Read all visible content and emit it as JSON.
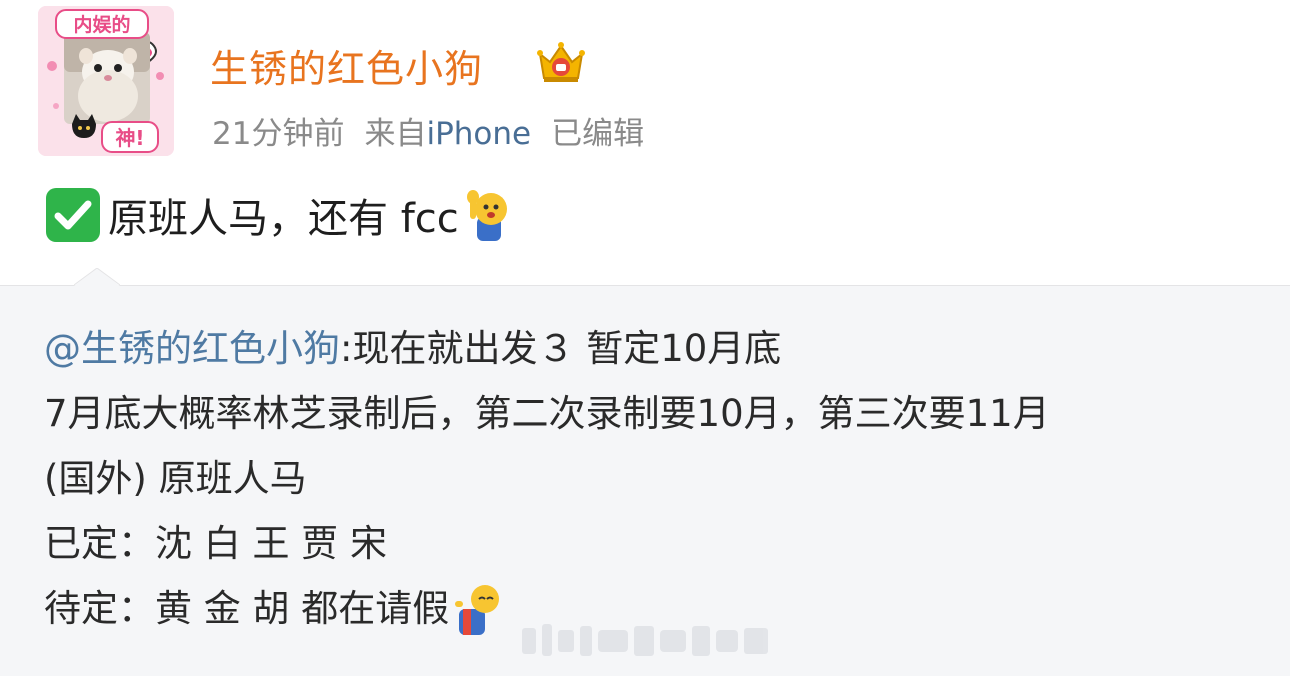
{
  "post": {
    "author": {
      "avatar_icon": "ferret-avatar",
      "avatar_text_top": "内娱的",
      "avatar_text_bottom": "神!",
      "name": "生锈的红色小狗",
      "badge_icon": "crown-badge-icon"
    },
    "meta": {
      "time": "21分钟前",
      "from_label": "来自",
      "source": "iPhone",
      "edited": "已编辑"
    },
    "body": {
      "check_icon": "check-mark-icon",
      "text": "原班人马，还有 fcc",
      "emoji_icon": "waving-emoji-icon"
    },
    "repost": {
      "mention": "@生锈的红色小狗",
      "line1": ":现在就出发３ 暂定10月底",
      "line2": "7月底大概率林芝录制后，第二次录制要10月，第三次要11月",
      "line3": "(国外) 原班人马",
      "line4": "已定：沈 白 王 贾 宋",
      "line5": "待定：黄 金 胡 都在请假",
      "line5_emoji_icon": "shrug-emoji-icon"
    },
    "colors": {
      "username": "#e8741f",
      "meta": "#8a8a8a",
      "source": "#496e95",
      "mention": "#4f7aa3",
      "repost_bg": "#f5f6f8",
      "text": "#1e1e1e"
    }
  }
}
